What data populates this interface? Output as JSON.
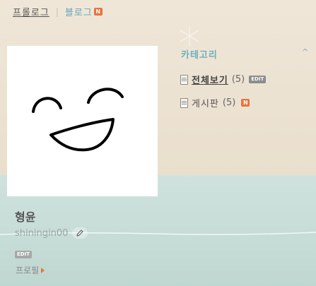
{
  "tabs": {
    "prologue": "프롤로그",
    "separator": "|",
    "blog": "블로그",
    "new_badge": "N"
  },
  "profile": {
    "image_alt": "smiley face drawing"
  },
  "category": {
    "title": "카테고리",
    "toggle_icon": "^",
    "items": [
      {
        "label": "전체보기",
        "count": "(5)",
        "badge": "EDIT"
      },
      {
        "label": "게시판",
        "count": "(5)",
        "badge": "N"
      }
    ]
  },
  "user": {
    "nickname": "형윤",
    "user_id": "shiningin00",
    "edit_badge": "EDIT",
    "profile_link": "프로필"
  },
  "colors": {
    "accent": "#6bb0be",
    "new_badge": "#e8743b",
    "top_bg": "#ece2d2",
    "bottom_bg": "#c6dcd6"
  }
}
